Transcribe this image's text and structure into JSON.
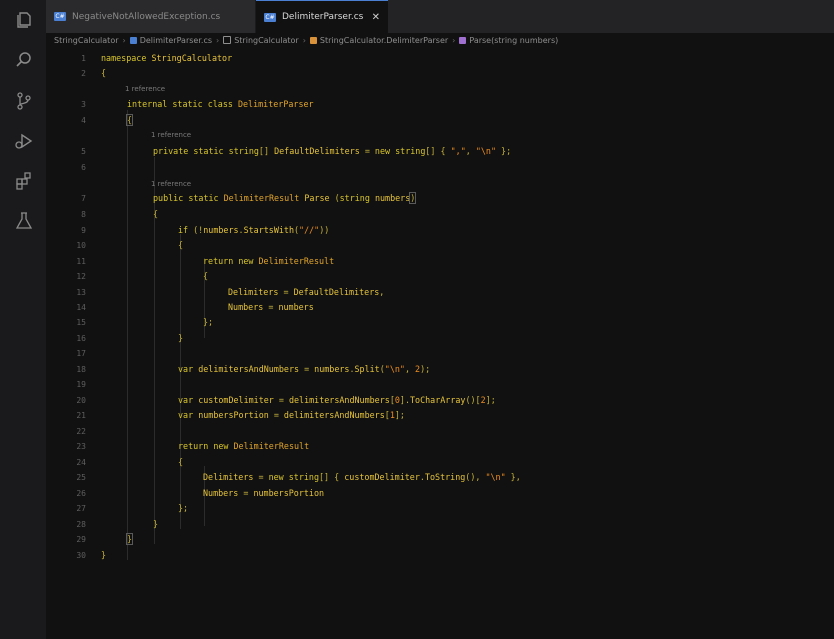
{
  "tabs": [
    {
      "label": "NegativeNotAllowedException.cs",
      "active": false
    },
    {
      "label": "DelimiterParser.cs",
      "active": true
    }
  ],
  "breadcrumb": [
    "StringCalculator",
    "DelimiterParser.cs",
    "StringCalculator",
    "StringCalculator.DelimiterParser",
    "Parse(string numbers)"
  ],
  "activity_icons": [
    "explorer-icon",
    "search-icon",
    "source-control-icon",
    "run-debug-icon",
    "extensions-icon",
    "testing-icon"
  ],
  "references_label": "1 reference",
  "line_numbers": [
    "1",
    "2",
    "3",
    "4",
    "5",
    "6",
    "7",
    "8",
    "9",
    "10",
    "11",
    "12",
    "13",
    "14",
    "15",
    "16",
    "17",
    "18",
    "19",
    "20",
    "21",
    "22",
    "23",
    "24",
    "25",
    "26",
    "27",
    "28",
    "29",
    "30"
  ],
  "code": {
    "l1": [
      "namespace",
      " ",
      "StringCalculator"
    ],
    "l2": [
      "{"
    ],
    "l3": [
      "internal",
      " ",
      "static",
      " ",
      "class",
      " ",
      "DelimiterParser"
    ],
    "l4": [
      "{"
    ],
    "l5": [
      "private",
      " ",
      "static",
      " ",
      "string",
      "[]",
      " ",
      "DefaultDelimiters",
      " = ",
      "new",
      " ",
      "string",
      "[]",
      " { ",
      "\",\"",
      ", ",
      "\"\\n\"",
      " };"
    ],
    "l7": [
      "public",
      " ",
      "static",
      " ",
      "DelimiterResult",
      " ",
      "Parse",
      " (",
      "string",
      " ",
      "numbers",
      ")"
    ],
    "l8": [
      "{"
    ],
    "l9": [
      "if",
      " (!",
      "numbers",
      ".",
      "StartsWith",
      "(",
      "\"//\"",
      "))"
    ],
    "l10": [
      "{"
    ],
    "l11": [
      "return",
      " ",
      "new",
      " ",
      "DelimiterResult"
    ],
    "l12": [
      "{"
    ],
    "l13": [
      "Delimiters",
      " = ",
      "DefaultDelimiters",
      ","
    ],
    "l14": [
      "Numbers",
      " = ",
      "numbers"
    ],
    "l15": [
      "};"
    ],
    "l16": [
      "}"
    ],
    "l18": [
      "var",
      " ",
      "delimitersAndNumbers",
      " = ",
      "numbers",
      ".",
      "Split",
      "(",
      "\"\\n\"",
      ", ",
      "2",
      ");"
    ],
    "l20": [
      "var",
      " ",
      "customDelimiter",
      " = ",
      "delimitersAndNumbers",
      "[",
      "0",
      "].",
      "ToCharArray",
      "()[",
      "2",
      "];"
    ],
    "l21": [
      "var",
      " ",
      "numbersPortion",
      " = ",
      "delimitersAndNumbers",
      "[",
      "1",
      "];"
    ],
    "l23": [
      "return",
      " ",
      "new",
      " ",
      "DelimiterResult"
    ],
    "l24": [
      "{"
    ],
    "l25": [
      "Delimiters",
      " = ",
      "new",
      " ",
      "string",
      "[]",
      " { ",
      "customDelimiter",
      ".",
      "ToString",
      "(), ",
      "\"\\n\"",
      " },"
    ],
    "l26": [
      "Numbers",
      " = ",
      "numbersPortion"
    ],
    "l27": [
      "};"
    ],
    "l28": [
      "}"
    ],
    "l29": [
      "}"
    ],
    "l30": [
      "}"
    ]
  },
  "colors": {
    "keyword": "#d9c62b",
    "type": "#e2a52a",
    "string": "#ef8e1e",
    "background": "#111112",
    "accent": "#4a7fd1"
  }
}
